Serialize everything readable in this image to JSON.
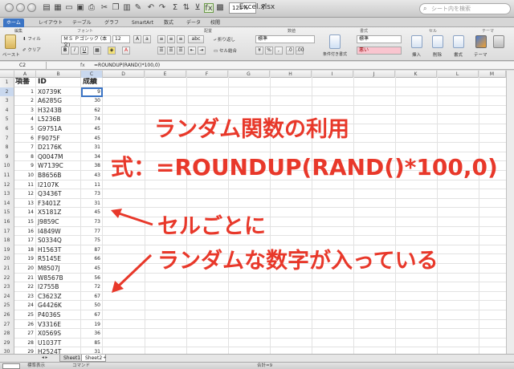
{
  "window": {
    "title": "Excel.xlsx",
    "zoom": "125%",
    "search_placeholder": "シート内を検索"
  },
  "ribbon_tabs": [
    {
      "label": "ホーム",
      "active": true
    },
    {
      "label": "レイアウト"
    },
    {
      "label": "テーブル"
    },
    {
      "label": "グラフ"
    },
    {
      "label": "SmartArt"
    },
    {
      "label": "数式"
    },
    {
      "label": "データ"
    },
    {
      "label": "校閲"
    }
  ],
  "ribbon": {
    "groups": {
      "edit": "編集",
      "font": "フォント",
      "align": "配置",
      "number": "数値",
      "format": "書式",
      "cells": "セル",
      "theme": "テーマ"
    },
    "paste": "ペースト",
    "fill": "フィル",
    "clear": "クリア",
    "font_name": "ＭＳ Ｐゴシック (本文)",
    "font_size": "12",
    "wrap": "折り返し",
    "merge": "セル結合",
    "number_format": "標準",
    "cond_format": "条件付き書式",
    "style_normal": "標準",
    "style_bad": "悪い",
    "insert": "挿入",
    "delete": "削除",
    "format_btn": "書式",
    "theme_btn": "テーマ",
    "bold": "B",
    "italic": "I",
    "underline": "U",
    "abc": "abc"
  },
  "formula_bar": {
    "name_box": "C2",
    "fx": "fx",
    "formula": "=ROUNDUP(RAND()*100,0)"
  },
  "columns": [
    "A",
    "B",
    "C",
    "D",
    "E",
    "F",
    "G",
    "H",
    "I",
    "J",
    "K",
    "L",
    "M"
  ],
  "header_row": {
    "a": "項番",
    "b": "ID",
    "c": "成績"
  },
  "rows": [
    {
      "n": "1",
      "id": "X0739K",
      "score": "9"
    },
    {
      "n": "2",
      "id": "A6285G",
      "score": "30"
    },
    {
      "n": "3",
      "id": "H3243B",
      "score": "62"
    },
    {
      "n": "4",
      "id": "L5236B",
      "score": "74"
    },
    {
      "n": "5",
      "id": "G9751A",
      "score": "45"
    },
    {
      "n": "6",
      "id": "F9075F",
      "score": "45"
    },
    {
      "n": "7",
      "id": "D2176K",
      "score": "31"
    },
    {
      "n": "8",
      "id": "Q0047M",
      "score": "34"
    },
    {
      "n": "9",
      "id": "W7139C",
      "score": "38"
    },
    {
      "n": "10",
      "id": "B8656B",
      "score": "43"
    },
    {
      "n": "11",
      "id": "I2107K",
      "score": "11"
    },
    {
      "n": "12",
      "id": "Q3436T",
      "score": "73"
    },
    {
      "n": "13",
      "id": "F3401Z",
      "score": "31"
    },
    {
      "n": "14",
      "id": "X5181Z",
      "score": "45"
    },
    {
      "n": "15",
      "id": "J9859C",
      "score": "73"
    },
    {
      "n": "16",
      "id": "I4849W",
      "score": "77"
    },
    {
      "n": "17",
      "id": "S0334Q",
      "score": "75"
    },
    {
      "n": "18",
      "id": "H1563T",
      "score": "87"
    },
    {
      "n": "19",
      "id": "R5145E",
      "score": "66"
    },
    {
      "n": "20",
      "id": "M8507J",
      "score": "45"
    },
    {
      "n": "21",
      "id": "W8567B",
      "score": "56"
    },
    {
      "n": "22",
      "id": "I2755B",
      "score": "72"
    },
    {
      "n": "23",
      "id": "C3623Z",
      "score": "67"
    },
    {
      "n": "24",
      "id": "G4426K",
      "score": "50"
    },
    {
      "n": "25",
      "id": "P4036S",
      "score": "67"
    },
    {
      "n": "26",
      "id": "V3316E",
      "score": "19"
    },
    {
      "n": "27",
      "id": "X0569S",
      "score": "36"
    },
    {
      "n": "28",
      "id": "U1037T",
      "score": "85"
    },
    {
      "n": "29",
      "id": "H2524T",
      "score": "31"
    }
  ],
  "annotations": {
    "title": "ランダム関数の利用",
    "formula": "式：=ROUNDUP(RAND()*100,0)",
    "per_cell": "セルごとに",
    "random_numbers": "ランダムな数字が入っている"
  },
  "sheets": [
    {
      "label": "Sheet1"
    },
    {
      "label": "Sheet2",
      "active": true
    }
  ],
  "status": {
    "view": "標準表示",
    "mode": "コマンド",
    "sum": "合計=9"
  },
  "colors": {
    "annotation": "#e8382a",
    "accent": "#3b74c4"
  }
}
